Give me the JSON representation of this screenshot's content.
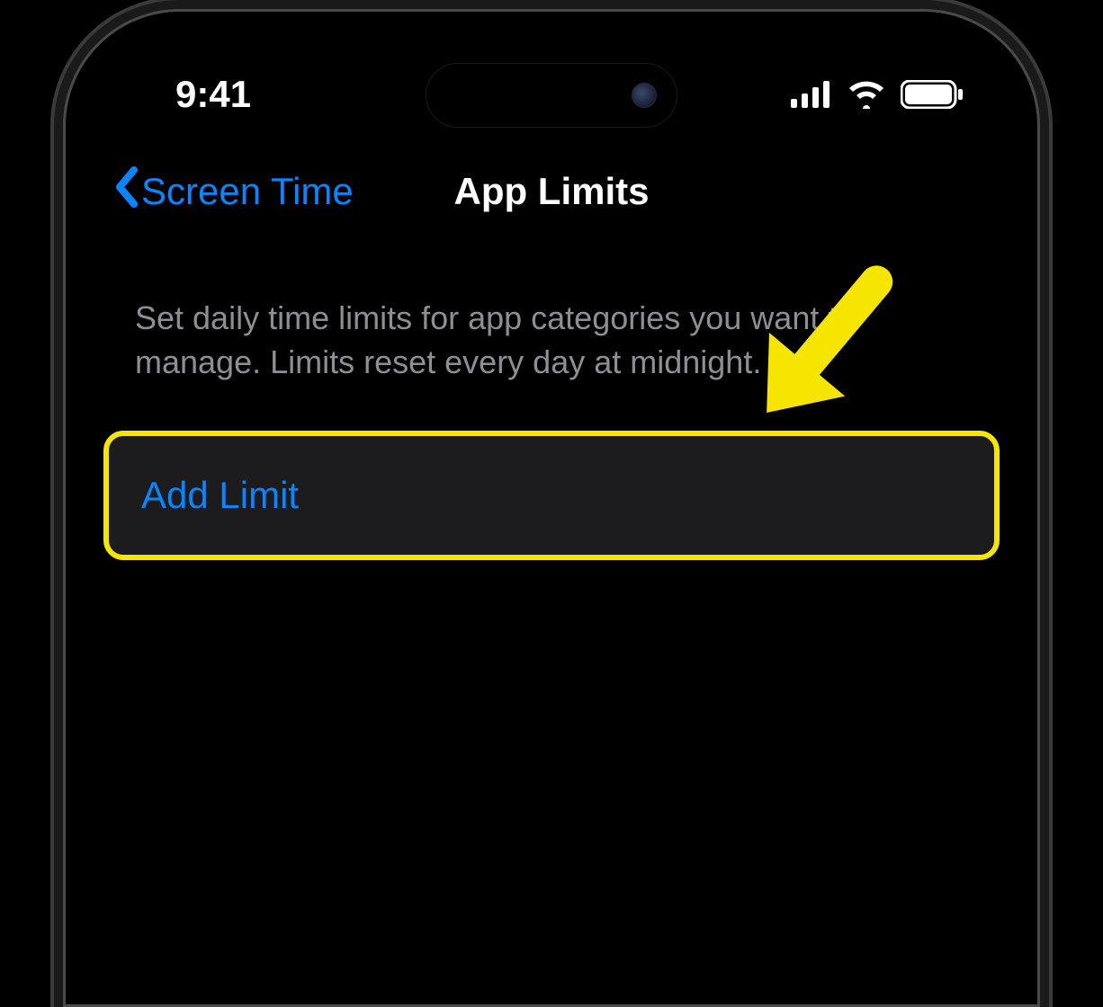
{
  "statusBar": {
    "time": "9:41"
  },
  "nav": {
    "backLabel": "Screen Time",
    "title": "App Limits"
  },
  "main": {
    "description": "Set daily time limits for app categories you want to manage. Limits reset every day at midnight.",
    "addLimitLabel": "Add Limit"
  },
  "annotation": {
    "highlightColor": "#f5e500",
    "arrowColor": "#f5e500"
  }
}
